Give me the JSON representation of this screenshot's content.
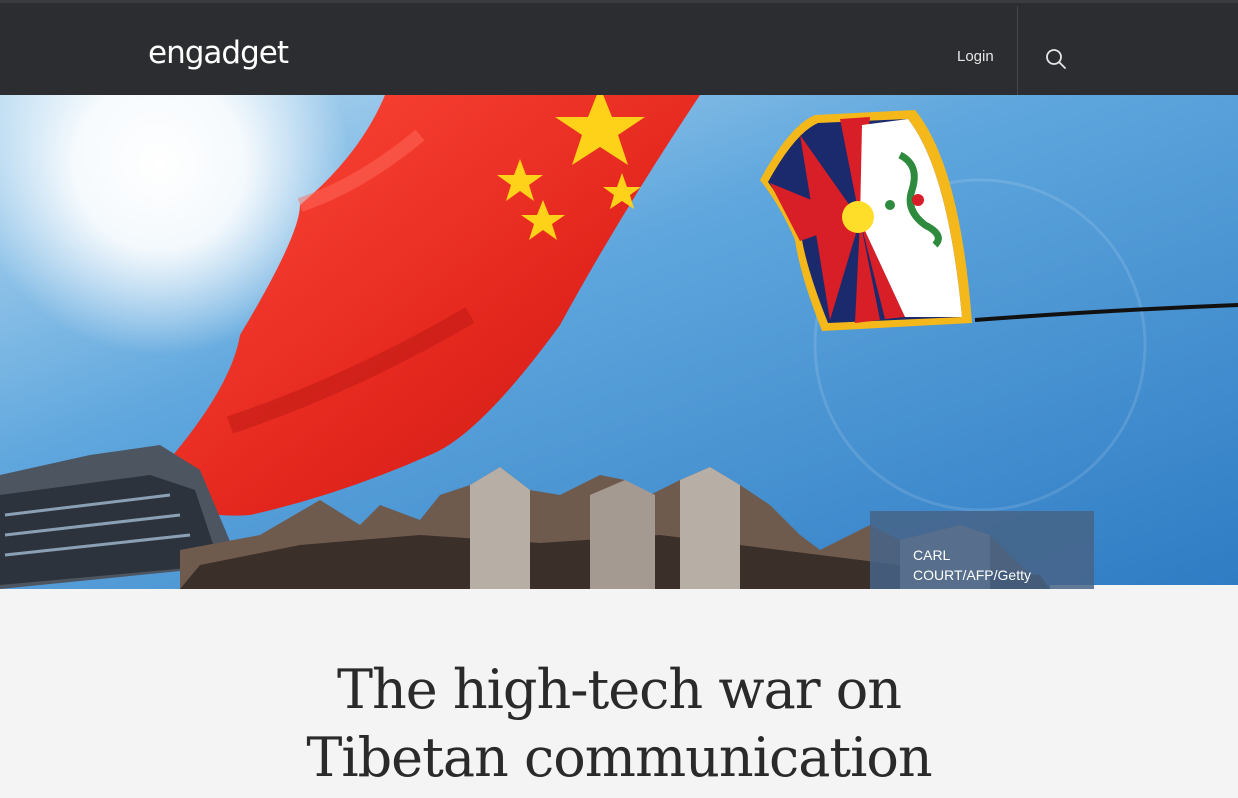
{
  "header": {
    "logo_text": "engadget",
    "login_label": "Login",
    "search_icon": "search-icon",
    "background_color": "#2c2d31"
  },
  "hero": {
    "image_description_icon": "flags-photo",
    "caption": "CARL COURT/AFP/Getty Images"
  },
  "article": {
    "title_line1": "The high-tech war on",
    "title_line2": "Tibetan communication"
  }
}
